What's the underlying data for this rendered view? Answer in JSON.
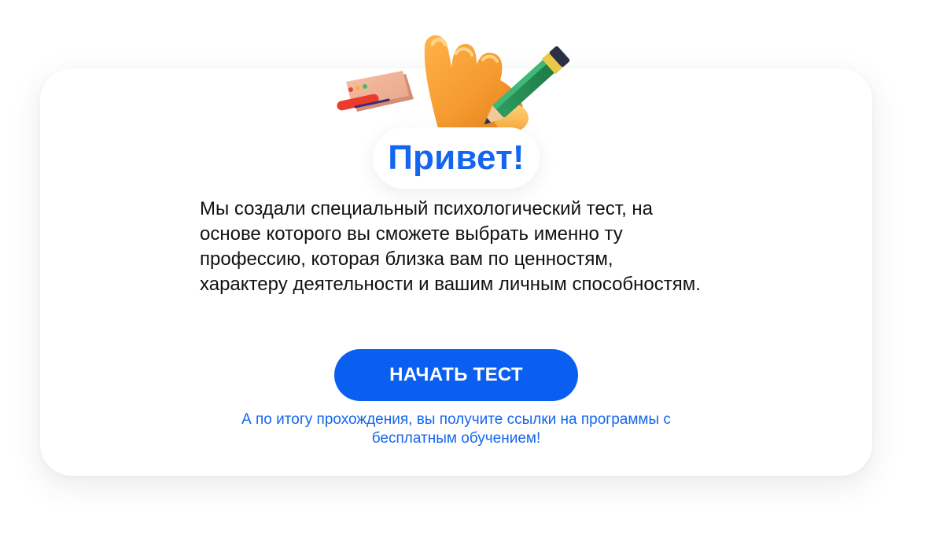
{
  "greeting": {
    "title": "Привет!"
  },
  "intro": {
    "text": "Мы создали специальный психологический тест, на основе которого вы сможете выбрать именно ту профессию, которая близка вам по ценностям, характеру деятельности и вашим личным способностям."
  },
  "cta": {
    "label": "НАЧАТЬ ТЕСТ"
  },
  "note": {
    "text": "А по итогу прохождения, вы получите ссылки на программы с бесплатным обучением!"
  },
  "illustration": {
    "icons": [
      "card-icon",
      "hand-icon",
      "pencil-icon"
    ]
  },
  "colors": {
    "accent": "#1466F0",
    "button": "#0B5FF0",
    "text": "#111111",
    "background": "#FFFFFF"
  }
}
